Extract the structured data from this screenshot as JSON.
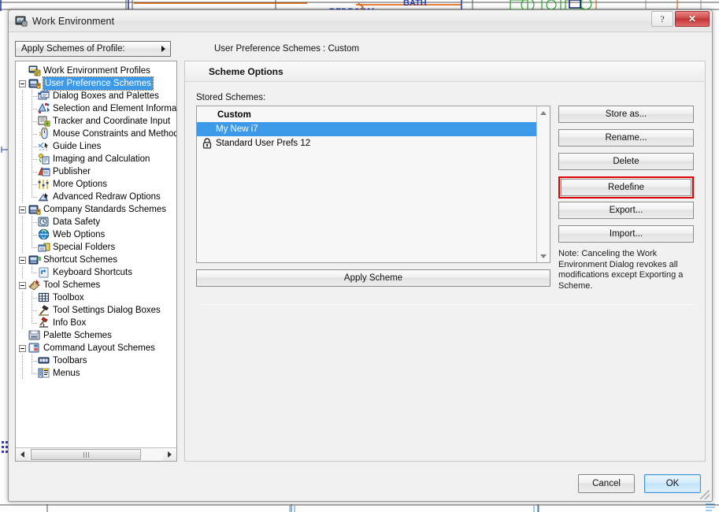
{
  "window": {
    "title": "Work Environment",
    "icon": "work-environment-icon",
    "help_label": "?",
    "close_label": "✕"
  },
  "toolbar": {
    "profile_button_label": "Apply Schemes of Profile:",
    "scheme_caption": "User Preference Schemes : Custom"
  },
  "tree": {
    "items": [
      {
        "label": "Work Environment Profiles",
        "depth": 0,
        "icon": "monitor-profiles-icon",
        "expander": false,
        "selected": false
      },
      {
        "label": "User Preference Schemes",
        "depth": 0,
        "icon": "folder-user-icon",
        "expander": true,
        "selected": true
      },
      {
        "label": "Dialog Boxes and Palettes",
        "depth": 1,
        "icon": "dialog-boxes-icon",
        "expander": false,
        "selected": false
      },
      {
        "label": "Selection and Element Information",
        "depth": 1,
        "icon": "selection-element-icon",
        "expander": false,
        "selected": false
      },
      {
        "label": "Tracker and Coordinate Input",
        "depth": 1,
        "icon": "tracker-coordinate-icon",
        "expander": false,
        "selected": false
      },
      {
        "label": "Mouse Constraints and Methods",
        "depth": 1,
        "icon": "mouse-icon",
        "expander": false,
        "selected": false
      },
      {
        "label": "Guide Lines",
        "depth": 1,
        "icon": "guide-lines-icon",
        "expander": false,
        "selected": false
      },
      {
        "label": "Imaging and Calculation",
        "depth": 1,
        "icon": "imaging-calculation-icon",
        "expander": false,
        "selected": false
      },
      {
        "label": "Publisher",
        "depth": 1,
        "icon": "publisher-icon",
        "expander": false,
        "selected": false
      },
      {
        "label": "More Options",
        "depth": 1,
        "icon": "more-options-icon",
        "expander": false,
        "selected": false
      },
      {
        "label": "Advanced Redraw Options",
        "depth": 1,
        "icon": "advanced-redraw-icon",
        "expander": false,
        "selected": false
      },
      {
        "label": "Company Standards Schemes",
        "depth": 0,
        "icon": "folder-company-icon",
        "expander": true,
        "selected": false
      },
      {
        "label": "Data Safety",
        "depth": 1,
        "icon": "data-safety-icon",
        "expander": false,
        "selected": false
      },
      {
        "label": "Web Options",
        "depth": 1,
        "icon": "globe-icon",
        "expander": false,
        "selected": false
      },
      {
        "label": "Special Folders",
        "depth": 1,
        "icon": "special-folders-icon",
        "expander": false,
        "selected": false
      },
      {
        "label": "Shortcut Schemes",
        "depth": 0,
        "icon": "folder-shortcut-icon",
        "expander": true,
        "selected": false
      },
      {
        "label": "Keyboard Shortcuts",
        "depth": 1,
        "icon": "keyboard-shortcut-icon",
        "expander": false,
        "selected": false
      },
      {
        "label": "Tool Schemes",
        "depth": 0,
        "icon": "tool-schemes-icon",
        "expander": true,
        "selected": false
      },
      {
        "label": "Toolbox",
        "depth": 1,
        "icon": "toolbox-grid-icon",
        "expander": false,
        "selected": false
      },
      {
        "label": "Tool Settings Dialog Boxes",
        "depth": 1,
        "icon": "hammer-icon",
        "expander": false,
        "selected": false
      },
      {
        "label": "Info Box",
        "depth": 1,
        "icon": "info-box-icon",
        "expander": false,
        "selected": false
      },
      {
        "label": "Palette Schemes",
        "depth": 0,
        "icon": "palette-schemes-icon",
        "expander": false,
        "selected": false
      },
      {
        "label": "Command Layout Schemes",
        "depth": 0,
        "icon": "command-layout-icon",
        "expander": true,
        "selected": false
      },
      {
        "label": "Toolbars",
        "depth": 1,
        "icon": "toolbars-icon",
        "expander": false,
        "selected": false
      },
      {
        "label": "Menus",
        "depth": 1,
        "icon": "menus-icon",
        "expander": false,
        "selected": false
      }
    ]
  },
  "content": {
    "header": "Scheme Options",
    "stored_schemes_label": "Stored Schemes:",
    "list": [
      {
        "label": "Custom",
        "group": true,
        "selected": false,
        "locked": false
      },
      {
        "label": "My New i7",
        "group": false,
        "selected": true,
        "locked": false
      },
      {
        "label": "Standard User Prefs 12",
        "group": false,
        "selected": false,
        "locked": true
      }
    ],
    "apply_scheme_label": "Apply Scheme",
    "buttons": [
      {
        "label": "Store as...",
        "highlighted": false
      },
      {
        "label": "Rename...",
        "highlighted": false
      },
      {
        "label": "Delete",
        "highlighted": false
      },
      {
        "label": "Redefine",
        "highlighted": true
      },
      {
        "label": "Export...",
        "highlighted": false
      },
      {
        "label": "Import...",
        "highlighted": false
      }
    ],
    "note": "Note: Canceling the Work Environment Dialog revokes all modifications except Exporting a Scheme."
  },
  "footer": {
    "cancel_label": "Cancel",
    "ok_label": "OK"
  },
  "colors": {
    "selection_blue": "#3d9ae8",
    "highlight_red": "#e00000",
    "dialog_bg": "#f0f0f0"
  }
}
